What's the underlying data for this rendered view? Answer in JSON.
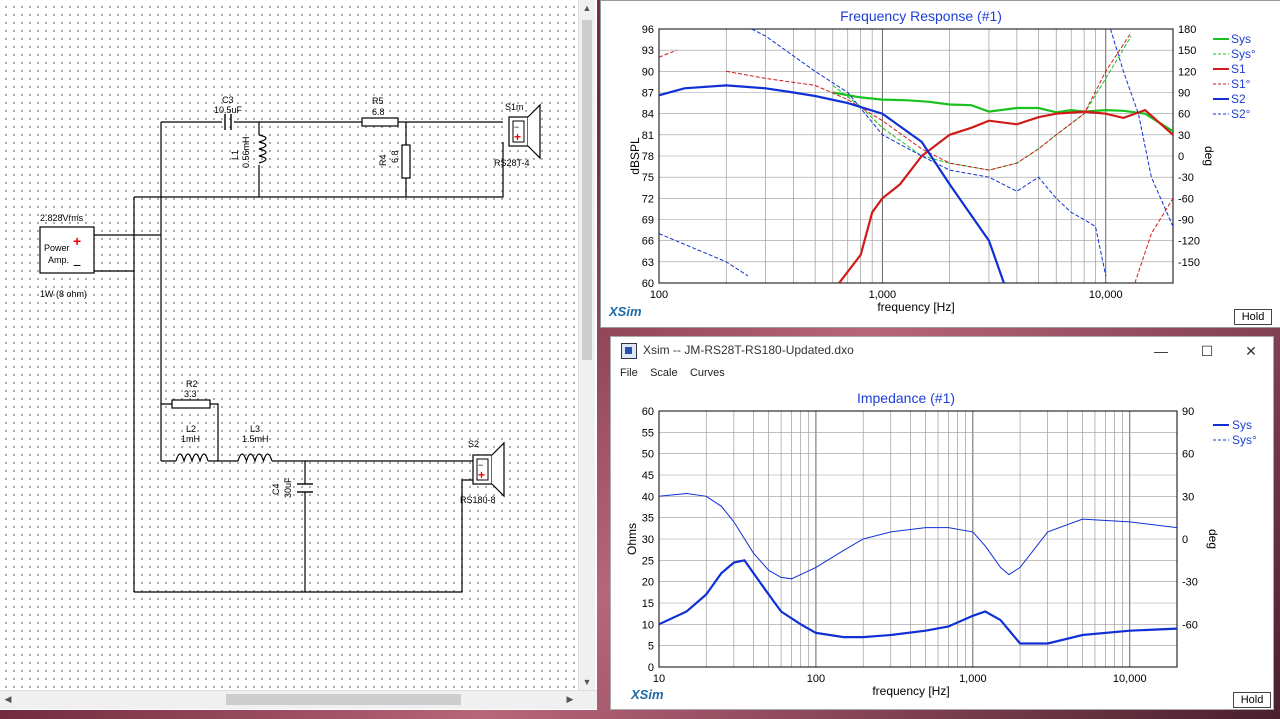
{
  "schematic": {
    "source_label": "2.828Vrms",
    "amp_label_1": "Power",
    "amp_label_2": "Amp.",
    "amp_plus": "+",
    "amp_minus": "−",
    "load_label": "1W (8 ohm)",
    "c3_name": "C3",
    "c3_value": "10.5uF",
    "l1_name": "L1",
    "l1_value": "0.56mH",
    "r5_name": "R5",
    "r5_value": "6.8",
    "r4_name": "R4",
    "r4_value": "6.8",
    "s1_name": "S1m",
    "s1_model": "RS28T-4",
    "r2_name": "R2",
    "r2_value": "3.3",
    "l2_name": "L2",
    "l2_value": "1mH",
    "l3_name": "L3",
    "l3_value": "1.5mH",
    "c4_name": "C4",
    "c4_value": "30uF",
    "s2_name": "S2",
    "s2_model": "RS180-8"
  },
  "freq_window": {
    "title": "Frequency Response (#1)",
    "logo": "XSim",
    "hold_label": "Hold",
    "xlabel": "frequency [Hz]",
    "ylabel_left": "dBSPL",
    "ylabel_right": "deg",
    "x_ticks": [
      "100",
      "1,000",
      "10,000"
    ],
    "y_ticks_left": [
      "96",
      "93",
      "90",
      "87",
      "84",
      "81",
      "78",
      "75",
      "72",
      "69",
      "66",
      "63",
      "60"
    ],
    "y_ticks_right": [
      "180",
      "150",
      "120",
      "90",
      "60",
      "30",
      "0",
      "-30",
      "-60",
      "-90",
      "-120",
      "-150"
    ],
    "legend": [
      "Sys",
      "Sys°",
      "S1",
      "S1°",
      "S2",
      "S2°"
    ]
  },
  "imp_window": {
    "window_title": "Xsim -- JM-RS28T-RS180-Updated.dxo",
    "menu": [
      "File",
      "Scale",
      "Curves"
    ],
    "title": "Impedance (#1)",
    "logo": "XSim",
    "hold_label": "Hold",
    "xlabel": "frequency [Hz]",
    "ylabel_left": "Ohms",
    "ylabel_right": "deg",
    "x_ticks": [
      "10",
      "100",
      "1,000",
      "10,000"
    ],
    "y_ticks_left": [
      "60",
      "55",
      "50",
      "45",
      "40",
      "35",
      "30",
      "25",
      "20",
      "15",
      "10",
      "5",
      "0"
    ],
    "y_ticks_right": [
      "90",
      "60",
      "30",
      "0",
      "-30",
      "-60"
    ],
    "legend": [
      "Sys",
      "Sys°"
    ],
    "min_icon": "minimize-icon",
    "max_icon": "maximize-icon",
    "close_icon": "close-icon"
  },
  "chart_data": [
    {
      "type": "line",
      "title": "Frequency Response (#1)",
      "xlabel": "frequency [Hz]",
      "ylabel": "dBSPL",
      "y2label": "deg",
      "xscale": "log",
      "xlim": [
        100,
        20000
      ],
      "ylim": [
        60,
        96
      ],
      "y2lim": [
        -180,
        180
      ],
      "grid": true,
      "legend_position": "right",
      "series": [
        {
          "name": "Sys",
          "color": "#17c21f",
          "axis": "left",
          "style": "solid",
          "x": [
            600,
            800,
            1000,
            1300,
            1600,
            2000,
            2500,
            3000,
            4000,
            5000,
            6000,
            7000,
            8000,
            10000,
            12000,
            15000,
            20000
          ],
          "y": [
            87,
            86.3,
            86,
            85.9,
            85.7,
            85.3,
            85.2,
            84.3,
            84.8,
            84.8,
            84.2,
            84.5,
            84.3,
            84.5,
            84.4,
            84,
            81.5
          ]
        },
        {
          "name": "Sys°",
          "color": "#17c21f",
          "axis": "right",
          "style": "dashed",
          "x": [
            600,
            800,
            1000,
            1500,
            2000,
            3000,
            4000,
            5000,
            6000,
            8000,
            10000,
            13000
          ],
          "y": [
            100,
            70,
            40,
            0,
            -10,
            -20,
            -10,
            10,
            30,
            60,
            110,
            170
          ]
        },
        {
          "name": "S1",
          "color": "#d11b1b",
          "axis": "left",
          "style": "solid",
          "x": [
            640,
            800,
            900,
            1000,
            1200,
            1500,
            2000,
            2500,
            3000,
            4000,
            5000,
            6000,
            8000,
            10000,
            12000,
            15000,
            20000
          ],
          "y": [
            60,
            64,
            70,
            72,
            74,
            78,
            81,
            82,
            83,
            82.5,
            83.5,
            84,
            84.3,
            84,
            83.4,
            84.5,
            81
          ]
        },
        {
          "name": "S1°",
          "color": "#d11b1b",
          "axis": "right",
          "style": "dashed",
          "x": [
            100,
            120,
            130,
            200,
            300,
            500,
            700,
            1000,
            1500,
            2000,
            3000,
            4000,
            5000,
            6000,
            8000,
            10000,
            13000,
            13500,
            16000,
            20000
          ],
          "y": [
            140,
            150,
            -170,
            120,
            110,
            100,
            80,
            50,
            10,
            -10,
            -20,
            -10,
            10,
            30,
            60,
            120,
            175,
            -180,
            -110,
            -60
          ]
        },
        {
          "name": "S2",
          "color": "#1030d6",
          "axis": "left",
          "style": "solid",
          "x": [
            100,
            130,
            200,
            300,
            400,
            500,
            700,
            1000,
            1500,
            2000,
            3000,
            3500
          ],
          "y": [
            86.6,
            87.6,
            88,
            87.6,
            87,
            86.5,
            85.5,
            84,
            80,
            74,
            66,
            60
          ]
        },
        {
          "name": "S2°",
          "color": "#1030d6",
          "axis": "right",
          "style": "dashed",
          "x": [
            100,
            200,
            250,
            260,
            300,
            500,
            700,
            1000,
            1500,
            2000,
            3000,
            4000,
            5000,
            6000,
            7000,
            8000,
            9000,
            10000,
            10500,
            12000,
            14000,
            16000,
            20000
          ],
          "y": [
            -110,
            -150,
            -170,
            180,
            170,
            120,
            90,
            30,
            0,
            -20,
            -30,
            -50,
            -30,
            -60,
            -80,
            -90,
            -100,
            -170,
            180,
            120,
            60,
            -30,
            -100
          ]
        }
      ]
    },
    {
      "type": "line",
      "title": "Impedance (#1)",
      "xlabel": "frequency [Hz]",
      "ylabel": "Ohms",
      "y2label": "deg",
      "xscale": "log",
      "xlim": [
        10,
        20000
      ],
      "ylim": [
        0,
        60
      ],
      "y2lim": [
        -90,
        90
      ],
      "grid": true,
      "legend_position": "right",
      "series": [
        {
          "name": "Sys",
          "color": "#1030d6",
          "axis": "left",
          "style": "solid",
          "x": [
            10,
            15,
            20,
            25,
            30,
            35,
            40,
            50,
            60,
            80,
            100,
            150,
            200,
            300,
            500,
            700,
            1000,
            1200,
            1500,
            2000,
            3000,
            5000,
            10000,
            20000
          ],
          "y": [
            10,
            13,
            17,
            22,
            24.5,
            25,
            22,
            17,
            13,
            10,
            8,
            7,
            7,
            7.5,
            8.5,
            9.5,
            12,
            13,
            11,
            5.5,
            5.5,
            7.5,
            8.5,
            9
          ]
        },
        {
          "name": "Sys°",
          "color": "#1030d6",
          "axis": "right",
          "style": "solid",
          "x": [
            10,
            15,
            20,
            25,
            30,
            40,
            50,
            60,
            70,
            80,
            100,
            150,
            200,
            300,
            500,
            700,
            1000,
            1200,
            1500,
            1700,
            2000,
            3000,
            5000,
            10000,
            20000
          ],
          "y": [
            30,
            32,
            30,
            23,
            12,
            -10,
            -22,
            -27,
            -28,
            -25,
            -20,
            -8,
            0,
            5,
            8,
            8,
            5,
            -5,
            -20,
            -25,
            -20,
            5,
            14,
            12,
            8
          ]
        }
      ]
    }
  ]
}
